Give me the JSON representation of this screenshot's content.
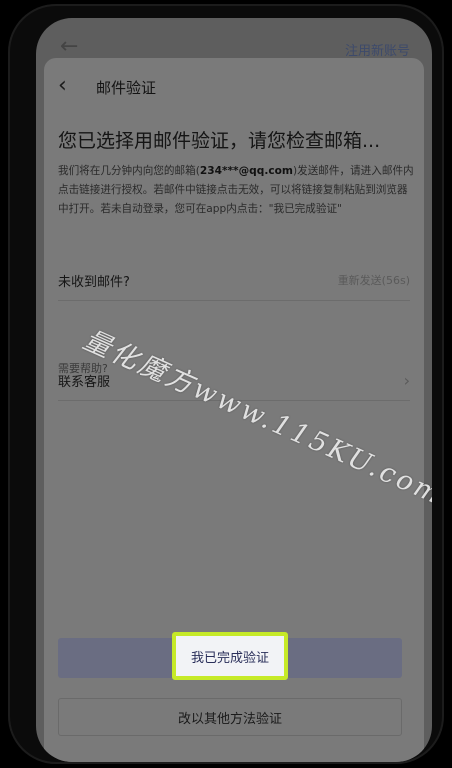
{
  "under": {
    "back_glyph": "←",
    "register_link": "注用新账号"
  },
  "sheet": {
    "back_glyph": "‹",
    "title": "邮件验证",
    "headline": "您已选择用邮件验证，请您检查邮箱...",
    "desc": {
      "part1": "我们将在几分钟内向您的邮箱(",
      "email": "234***@qq.com",
      "part2": ")发送邮件，请进入邮件内点击链接进行授权。若邮件中链接点击无效，可以将链接复制粘贴到浏览器中打开。若未自动登录，您可在app内点击：\"我已完成验证\""
    },
    "not_received_label": "未收到邮件?",
    "resend_label": "重新发送(56s)",
    "help_label": "需要帮助?",
    "contact_label": "联系客服",
    "primary_button": "我已完成验证",
    "secondary_button": "改以其他方法验证"
  },
  "watermark": "量化魔方www.115KU.com",
  "colors": {
    "highlight_border": "#c6ea28",
    "primary_button_bar": "#6a6d82",
    "overlay": "#5e5e5e"
  },
  "icons": {
    "back": "chevron-left-icon",
    "contact_arrow": "chevron-right-icon"
  }
}
